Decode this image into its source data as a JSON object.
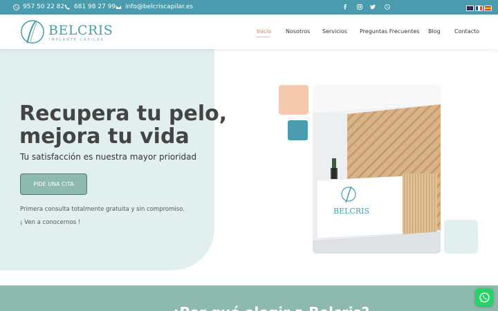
{
  "topbar": {
    "phone1": "957 50 22 82",
    "phone2": "681 98 27 99",
    "email": "info@belcriscapilar.es",
    "social": [
      "facebook-icon",
      "instagram-icon",
      "twitter-icon",
      "whatsapp-icon"
    ],
    "languages": [
      "English",
      "Français",
      "Español"
    ],
    "color": "#4a9bae"
  },
  "brand": {
    "name": "BELCRIS",
    "tagline": "IMPLANTE CAPILAR"
  },
  "nav": {
    "items": [
      "Inicio",
      "Nosotros",
      "Servicios",
      "Preguntas Frecuentes",
      "Blog",
      "Contacto"
    ],
    "active": "Inicio"
  },
  "hero": {
    "headline_line1": "Recupera tu pelo,",
    "headline_line2": "mejora tu vida",
    "subheadline": "Tu satisfacción es nuestra mayor prioridad",
    "cta_label": "PIDE UNA CITA",
    "note1": "Primera consulta totalmente gratuita y sin compromiso.",
    "note2": "¡ Ven a conocernos !",
    "photo_brand": "BELCRIS",
    "accent_colors": {
      "peach": "#f5c9ad",
      "teal": "#4a9bae",
      "mint": "#e1efee",
      "sage": "#8db9ae"
    }
  },
  "section": {
    "title": "¿Por qué elegir a Belcris?"
  }
}
